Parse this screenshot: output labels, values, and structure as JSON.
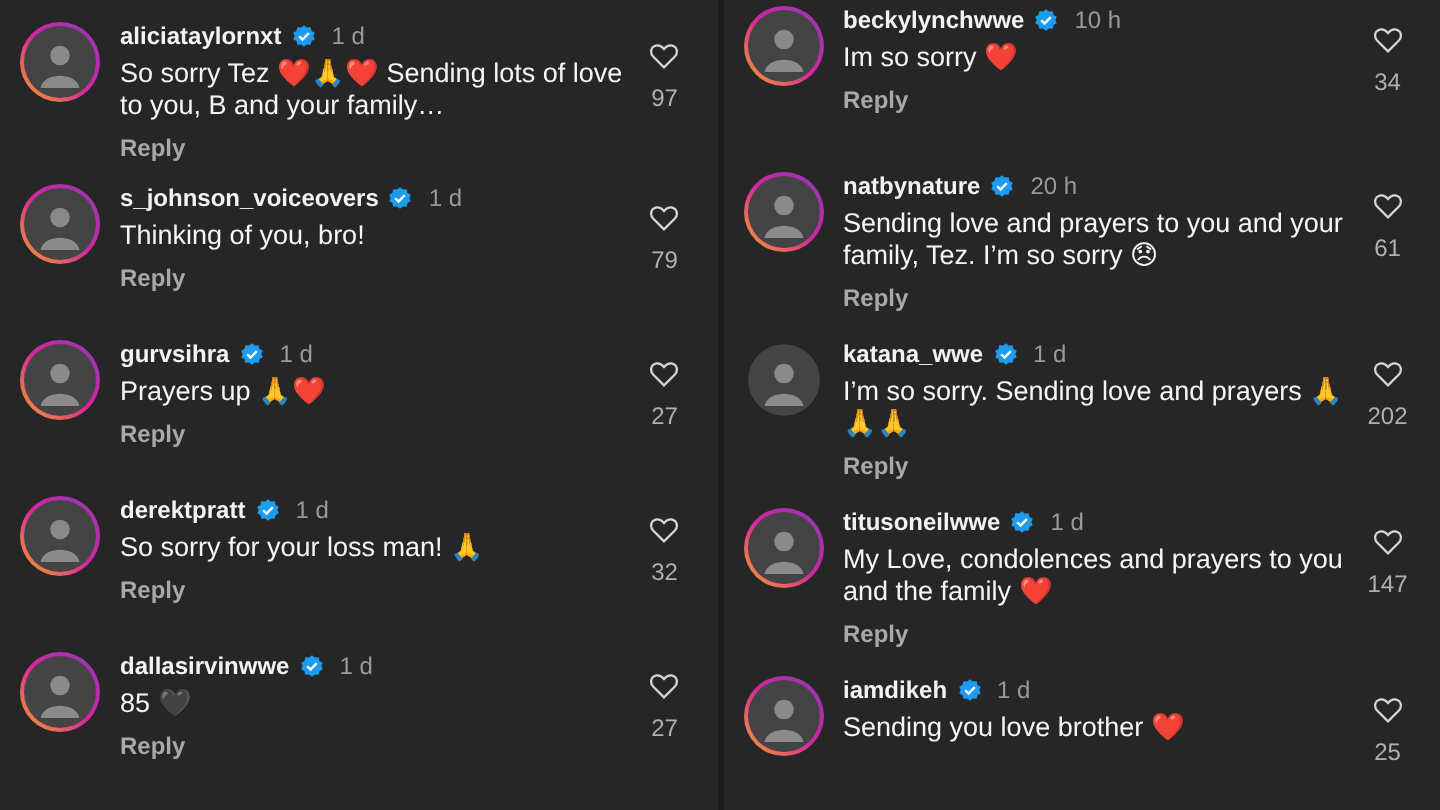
{
  "panels": [
    {
      "comments": [
        {
          "username": "aliciataylornxt",
          "verified": true,
          "time": "1 d",
          "text": "So sorry Tez ❤️🙏❤️ Sending lots of love to you, B and your family…",
          "reply": "Reply",
          "likes": "97",
          "story_ring": true
        },
        {
          "username": "s_johnson_voiceovers",
          "verified": true,
          "time": "1 d",
          "text": "Thinking of you, bro!",
          "reply": "Reply",
          "likes": "79",
          "story_ring": true
        },
        {
          "username": "gurvsihra",
          "verified": true,
          "time": "1 d",
          "text": "Prayers up 🙏❤️",
          "reply": "Reply",
          "likes": "27",
          "story_ring": true
        },
        {
          "username": "derektpratt",
          "verified": true,
          "time": "1 d",
          "text": "So sorry for your loss man! 🙏",
          "reply": "Reply",
          "likes": "32",
          "story_ring": true
        },
        {
          "username": "dallasirvinwwe",
          "verified": true,
          "time": "1 d",
          "text": "85 🖤",
          "reply": "Reply",
          "likes": "27",
          "story_ring": true
        }
      ]
    },
    {
      "comments": [
        {
          "username": "beckylynchwwe",
          "verified": true,
          "time": "10 h",
          "text": "Im so sorry ❤️",
          "reply": "Reply",
          "likes": "34",
          "story_ring": true
        },
        {
          "username": "natbynature",
          "verified": true,
          "time": "20 h",
          "text": "Sending love and prayers to you and your family, Tez. I’m so sorry 😞",
          "reply": "Reply",
          "likes": "61",
          "story_ring": true
        },
        {
          "username": "katana_wwe",
          "verified": true,
          "time": "1 d",
          "text": "I’m so sorry. Sending love and prayers 🙏🙏🙏",
          "reply": "Reply",
          "likes": "202",
          "story_ring": false
        },
        {
          "username": "titusoneilwwe",
          "verified": true,
          "time": "1 d",
          "text": "My Love, condolences and prayers to you and the family ❤️",
          "reply": "Reply",
          "likes": "147",
          "story_ring": true
        },
        {
          "username": "iamdikeh",
          "verified": true,
          "time": "1 d",
          "text": "Sending you love brother ❤️",
          "likes": "25",
          "story_ring": true
        }
      ]
    }
  ]
}
